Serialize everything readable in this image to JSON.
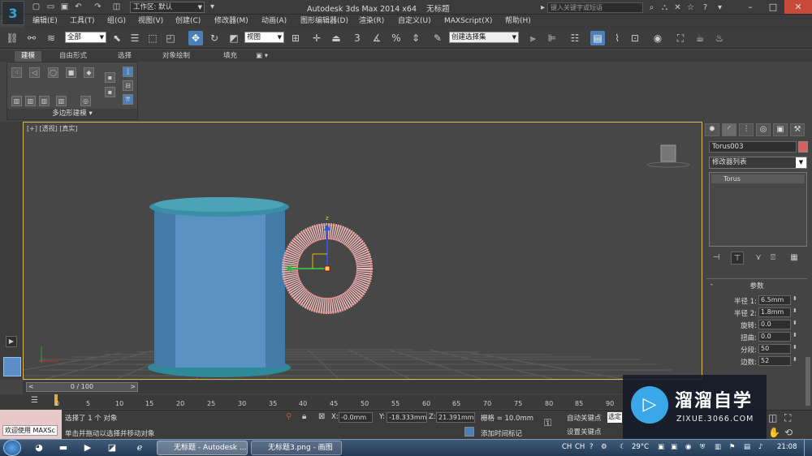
{
  "window": {
    "title": "Autodesk 3ds Max  2014 x64",
    "doc_title": "无标题",
    "workspace_label": "工作区: 默认",
    "search_placeholder": "键入关键字或短语",
    "controls": [
      "minimize-icon",
      "maximize-icon",
      "close-icon"
    ]
  },
  "menus": [
    "编辑(E)",
    "工具(T)",
    "组(G)",
    "视图(V)",
    "创建(C)",
    "修改器(M)",
    "动画(A)",
    "图形编辑器(D)",
    "渲染(R)",
    "自定义(U)",
    "MAXScript(X)",
    "帮助(H)"
  ],
  "toolbar": {
    "filter_select": "全部",
    "view_select": "视图",
    "snap_label": "3",
    "named_selection": "创建选择集"
  },
  "ribbon": {
    "tabs": [
      "建模",
      "自由形式",
      "选择",
      "对象绘制",
      "填充"
    ],
    "active_tab": "建模",
    "panel_label": "多边形建模"
  },
  "viewport": {
    "label": "[+] [透视] [真实]",
    "gizmo_label": "z"
  },
  "command_panel": {
    "object_name": "Torus003",
    "object_color": "#d86060",
    "modifier_list": "修改器列表",
    "stack_item": "Torus",
    "params_title": "参数",
    "params": [
      {
        "label": "半径 1:",
        "value": "6.5mm"
      },
      {
        "label": "半径 2:",
        "value": "1.8mm"
      },
      {
        "label": "旋转:",
        "value": "0.0"
      },
      {
        "label": "扭曲:",
        "value": "0.0"
      },
      {
        "label": "分段:",
        "value": "50"
      },
      {
        "label": "边数:",
        "value": "52"
      }
    ]
  },
  "timeline": {
    "slider": "0 / 100",
    "ticks": [
      "0",
      "5",
      "10",
      "15",
      "20",
      "25",
      "30",
      "35",
      "40",
      "45",
      "50",
      "55",
      "60",
      "65",
      "70",
      "75",
      "80",
      "85",
      "90"
    ]
  },
  "status": {
    "welcome": "欢迎使用 MAXSc",
    "selection": "选择了 1 个 对象",
    "hint": "单击并拖动以选择并移动对象",
    "x_label": "X:",
    "x": "-0.0mm",
    "y_label": "Y:",
    "y": "-18.333mm",
    "z_label": "Z:",
    "z": "21.391mm",
    "grid": "栅格 = 10.0mm",
    "add_time_tag": "添加时间标记",
    "auto_key": "自动关键点",
    "set_key": "设置关键点",
    "selected": "选定"
  },
  "taskbar": {
    "apps": [
      "无标题 - Autodesk ...",
      "无标题3.png - 画图"
    ],
    "lang1": "CH",
    "lang2": "CH",
    "temp": "29°C",
    "time": "21:08"
  },
  "watermark": {
    "title": "溜溜自学",
    "subtitle": "ZIXUE.3066.COM"
  }
}
